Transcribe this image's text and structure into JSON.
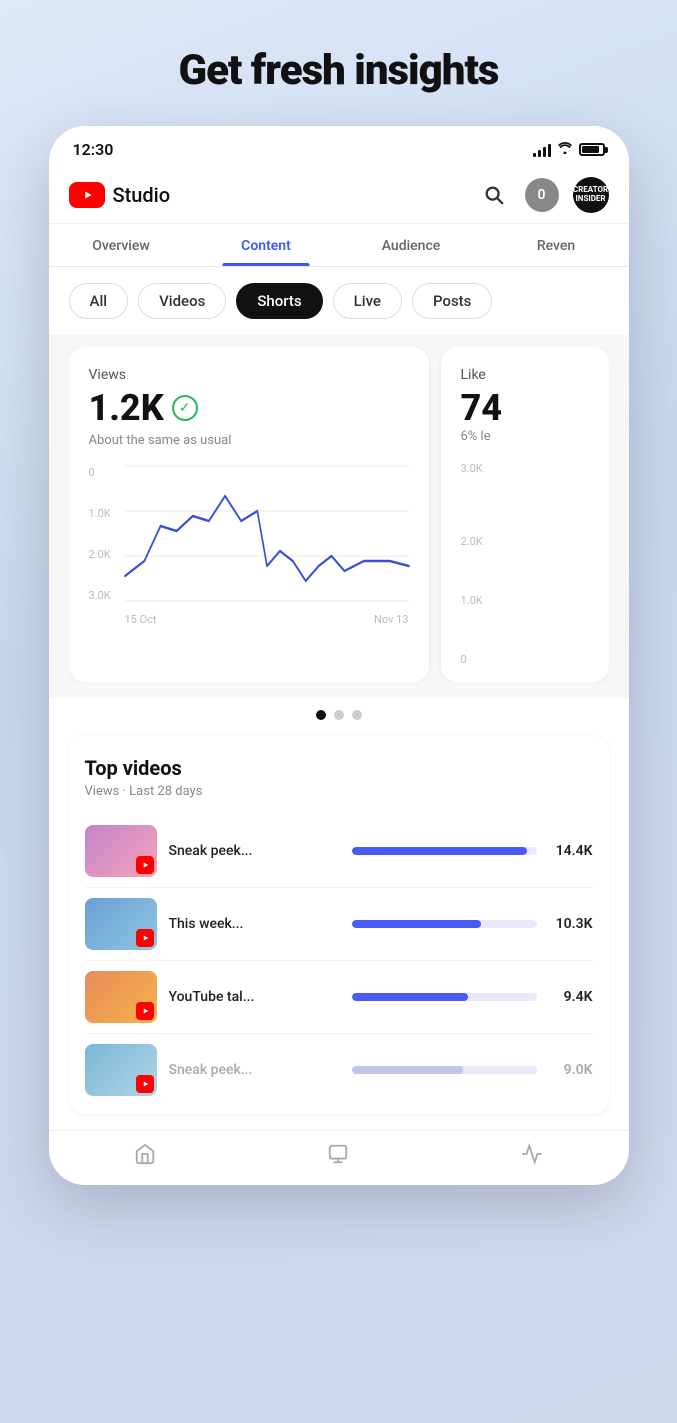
{
  "page": {
    "title": "Get fresh insights"
  },
  "status_bar": {
    "time": "12:30"
  },
  "app_header": {
    "logo_text": "Studio",
    "notification_count": "0",
    "avatar_label": "CREATOR\nINSIDER"
  },
  "tabs": [
    {
      "id": "overview",
      "label": "Overview",
      "active": false
    },
    {
      "id": "content",
      "label": "Content",
      "active": true
    },
    {
      "id": "audience",
      "label": "Audience",
      "active": false
    },
    {
      "id": "revenue",
      "label": "Reven",
      "active": false
    }
  ],
  "filter_pills": [
    {
      "id": "all",
      "label": "All",
      "active": false
    },
    {
      "id": "videos",
      "label": "Videos",
      "active": false
    },
    {
      "id": "shorts",
      "label": "Shorts",
      "active": true
    },
    {
      "id": "live",
      "label": "Live",
      "active": false
    },
    {
      "id": "posts",
      "label": "Posts",
      "active": false
    }
  ],
  "stats_card": {
    "label": "Views",
    "value": "1.2K",
    "description": "About the same as usual",
    "y_labels": [
      "3.0K",
      "2.0K",
      "1.0K",
      "0"
    ],
    "x_start": "15 Oct",
    "x_end": "Nov 13",
    "chart_color": "#3a4fd4"
  },
  "likes_card": {
    "label": "Likes",
    "value": "74",
    "description": "6% le"
  },
  "dots": [
    {
      "active": true
    },
    {
      "active": false
    },
    {
      "active": false
    }
  ],
  "top_videos": {
    "title": "Top videos",
    "subtitle": "Views · Last 28 days",
    "items": [
      {
        "title": "Sneak peek...",
        "count": "14.4K",
        "bar_pct": 95,
        "dimmed": false,
        "thumb_class": "thumb-bg-1"
      },
      {
        "title": "This week...",
        "count": "10.3K",
        "bar_pct": 70,
        "dimmed": false,
        "thumb_class": "thumb-bg-2"
      },
      {
        "title": "YouTube tal...",
        "count": "9.4K",
        "bar_pct": 63,
        "dimmed": false,
        "thumb_class": "thumb-bg-3"
      },
      {
        "title": "Sneak peek...",
        "count": "9.0K",
        "bar_pct": 60,
        "dimmed": true,
        "thumb_class": "thumb-bg-4"
      }
    ]
  }
}
